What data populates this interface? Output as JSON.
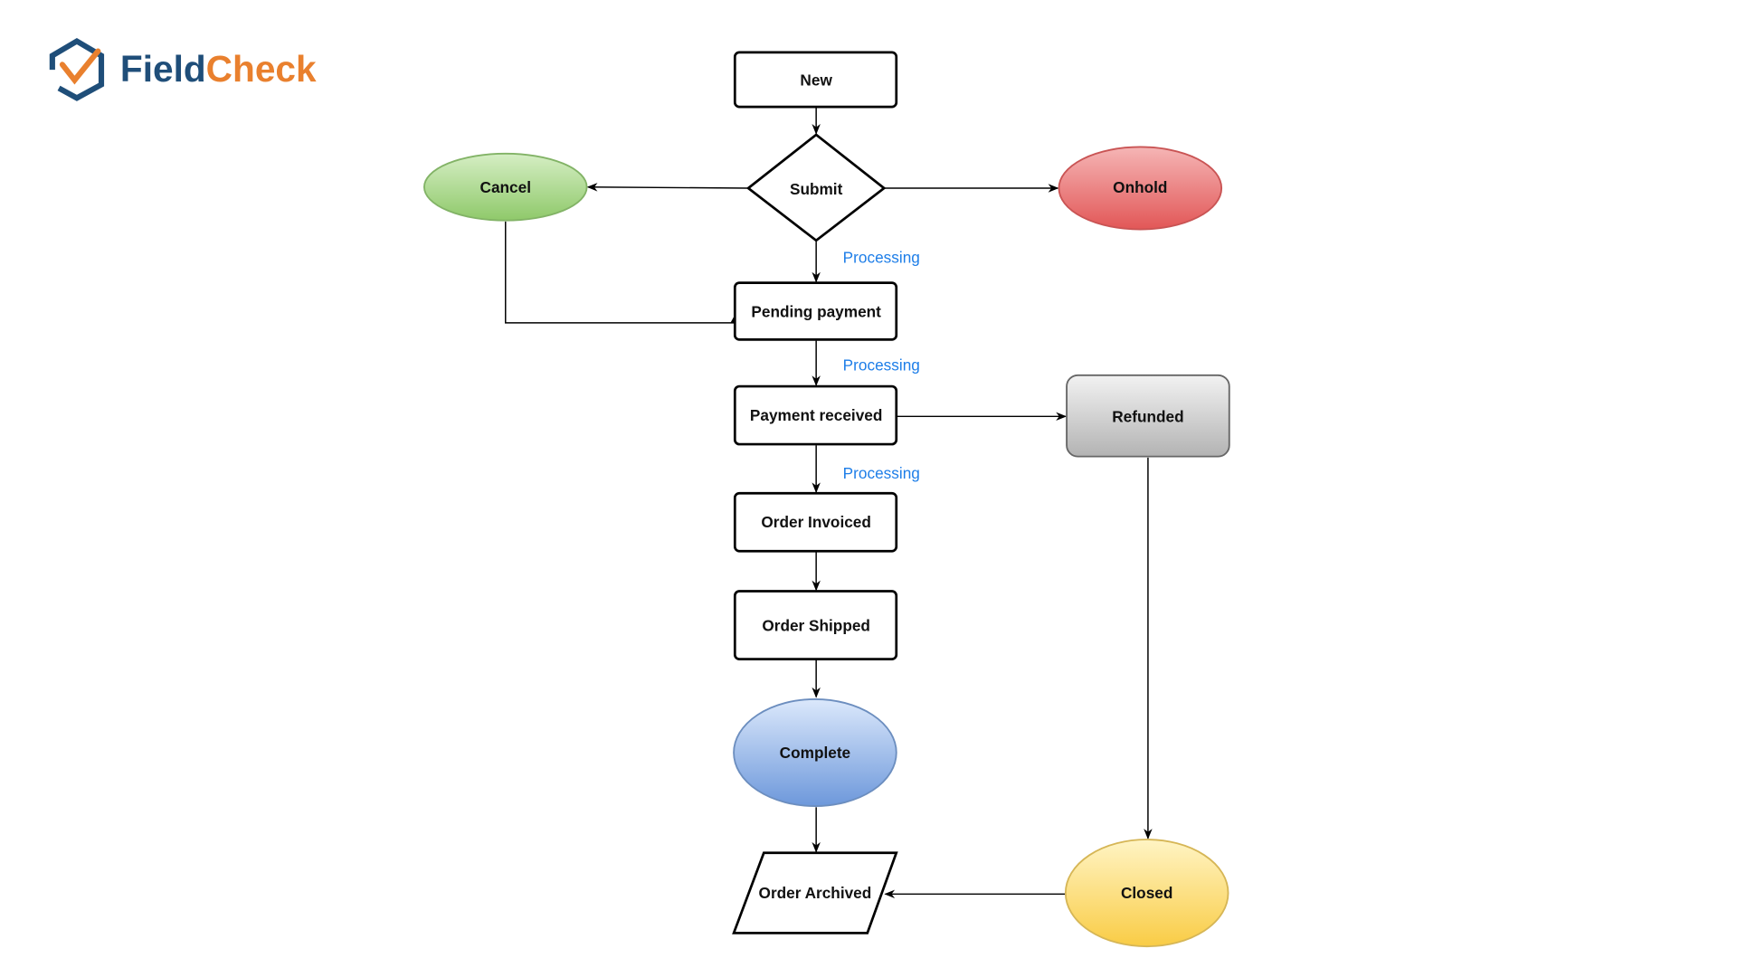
{
  "logo": {
    "part1": "Field",
    "part2": "Check",
    "colors": {
      "primary": "#1f4e79",
      "accent": "#e9802e"
    }
  },
  "nodes": {
    "new": "New",
    "submit": "Submit",
    "cancel": "Cancel",
    "onhold": "Onhold",
    "pending_payment": "Pending payment",
    "payment_received": "Payment received",
    "refunded": "Refunded",
    "order_invoiced": "Order Invoiced",
    "order_shipped": "Order Shipped",
    "complete": "Complete",
    "order_archived": "Order Archived",
    "closed": "Closed"
  },
  "edge_labels": {
    "submit_to_pending": "Processing",
    "pending_to_received": "Processing",
    "received_to_invoiced": "Processing"
  },
  "colors": {
    "cancel": "#9fd17f",
    "onhold": "#e86b6b",
    "refunded": "#c4c4c4",
    "complete": "#7ea6e0",
    "closed": "#fcd55a",
    "label": "#1e7ee8"
  }
}
